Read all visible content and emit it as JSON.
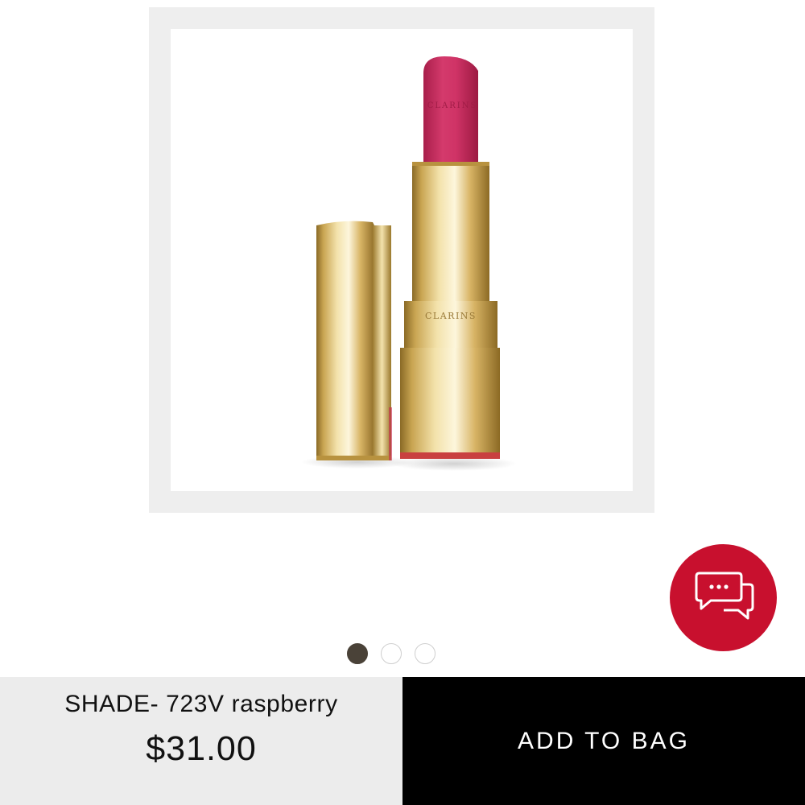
{
  "product": {
    "image_name": "lipstick-product-image",
    "brand_engraving": "CLARINS"
  },
  "carousel": {
    "total": 3,
    "active_index": 0
  },
  "chat": {
    "icon": "chat-bubbles-icon",
    "color": "#c8102e"
  },
  "bottom_bar": {
    "shade": "SHADE- 723V raspberry",
    "price": "$31.00",
    "add_to_bag": "ADD TO BAG"
  },
  "colors": {
    "lipstick": "#c8285e",
    "gold": "#d8b869",
    "add_to_bag_bg": "#000000",
    "info_bg": "#ececec"
  }
}
